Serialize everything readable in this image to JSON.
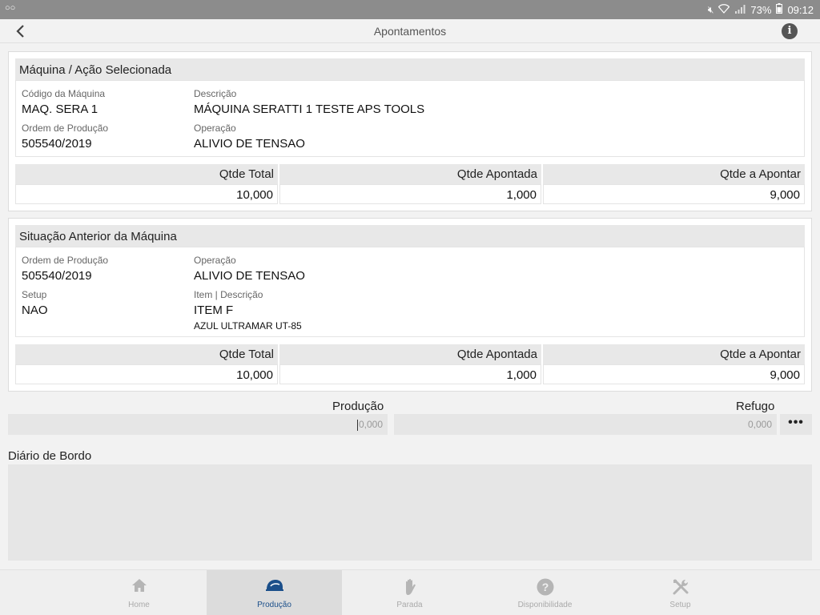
{
  "status_bar": {
    "voicemail_icon": "voicemail-icon",
    "battery": "73%",
    "time": "09:12"
  },
  "app_bar": {
    "title": "Apontamentos"
  },
  "selected": {
    "header": "Máquina / Ação Selecionada",
    "machine_code_label": "Código da Máquina",
    "machine_code": "MAQ. SERA 1",
    "description_label": "Descrição",
    "description": "MÁQUINA SERATTI 1 TESTE APS TOOLS",
    "order_label": "Ordem de Produção",
    "order": "505540/2019",
    "operation_label": "Operação",
    "operation": "ALIVIO DE TENSAO",
    "qty_headers": [
      "Qtde Total",
      "Qtde Apontada",
      "Qtde a Apontar"
    ],
    "qty_values": [
      "10,000",
      "1,000",
      "9,000"
    ]
  },
  "previous": {
    "header": "Situação Anterior da Máquina",
    "order_label": "Ordem de Produção",
    "order": "505540/2019",
    "operation_label": "Operação",
    "operation": "ALIVIO DE TENSAO",
    "setup_label": "Setup",
    "setup": "NAO",
    "item_label": "Item | Descrição",
    "item": "ITEM F",
    "item_description": "AZUL ULTRAMAR UT-85",
    "qty_headers": [
      "Qtde Total",
      "Qtde Apontada",
      "Qtde a Apontar"
    ],
    "qty_values": [
      "10,000",
      "1,000",
      "9,000"
    ]
  },
  "form": {
    "production_label": "Produção",
    "production_placeholder": "0,000",
    "scrap_label": "Refugo",
    "scrap_placeholder": "0,000",
    "more_label": "•••",
    "logbook_label": "Diário de Bordo"
  },
  "bottom_nav": {
    "items": [
      {
        "label": "Home",
        "icon": "home-icon"
      },
      {
        "label": "Produção",
        "icon": "hard-hat-icon"
      },
      {
        "label": "Parada",
        "icon": "hand-stop-icon"
      },
      {
        "label": "Disponibilidade",
        "icon": "question-circle-icon"
      },
      {
        "label": "Setup",
        "icon": "tools-icon"
      }
    ],
    "active_index": 1
  },
  "colors": {
    "status_bar": "#8c8c8c",
    "active_nav": "#1b4f8a",
    "header_bg": "#e8e8e8"
  }
}
